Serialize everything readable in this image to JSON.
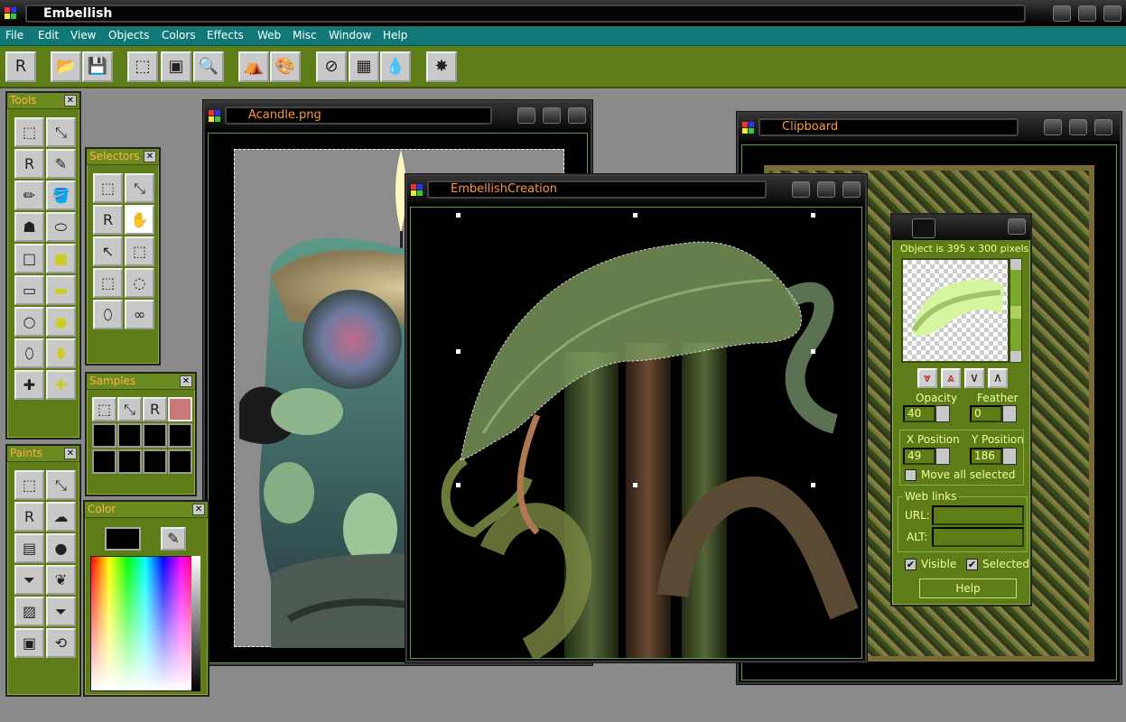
{
  "app": {
    "title": "Embellish"
  },
  "menu": [
    "File",
    "Edit",
    "View",
    "Objects",
    "Colors",
    "Effects",
    "Web",
    "Misc",
    "Window",
    "Help"
  ],
  "toolbar": {
    "icons": [
      "R",
      "📂",
      "💾",
      "⬚",
      "▣",
      "🔍",
      "⛺",
      "🎨",
      "⊘",
      "▦",
      "💧",
      "✸"
    ]
  },
  "palettes": {
    "tools": {
      "title": "Tools"
    },
    "selectors": {
      "title": "Selectors"
    },
    "samples": {
      "title": "Samples"
    },
    "paints": {
      "title": "Paints"
    },
    "color": {
      "title": "Color"
    }
  },
  "windows": {
    "acandle": {
      "title": "Acandle.png"
    },
    "creation": {
      "title": "EmbellishCreation"
    },
    "clipboard": {
      "title": "Clipboard"
    }
  },
  "props": {
    "object_size": "Object is 395 x 300 pixels",
    "opacity_label": "Opacity",
    "opacity_value": "40",
    "feather_label": "Feather",
    "feather_value": "0",
    "xpos_label": "X Position",
    "xpos_value": "49",
    "ypos_label": "Y Position",
    "ypos_value": "186",
    "move_all_label": "Move all selected",
    "weblinks_label": "Web links",
    "url_label": "URL:",
    "url_value": "",
    "alt_label": "ALT:",
    "alt_value": "",
    "visible_label": "Visible",
    "selected_label": "Selected",
    "help_label": "Help",
    "visible_checked": true,
    "selected_checked": true,
    "move_all_checked": false
  },
  "colors": {
    "accent_green": "#5e7d18",
    "teal_menu": "#117878",
    "title_orange": "#ff9a3c",
    "label_yellow": "#f2ff9a",
    "sample_swatch": "#c87878"
  }
}
